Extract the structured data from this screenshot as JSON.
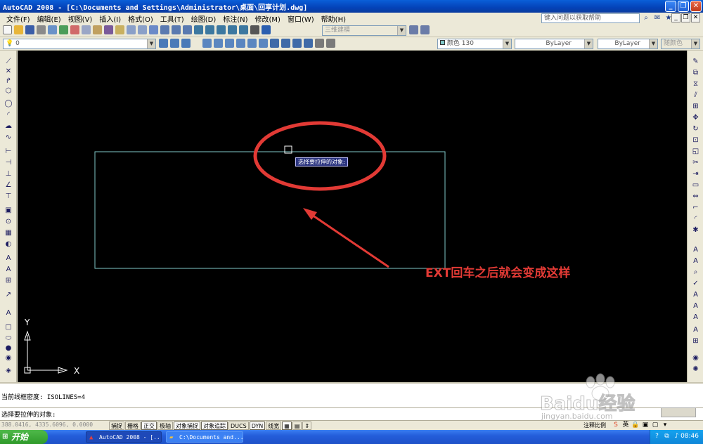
{
  "window": {
    "title": "AutoCAD 2008 - [C:\\Documents and Settings\\Administrator\\桌面\\回享计划.dwg]"
  },
  "menu": {
    "items": [
      "文件(F)",
      "编辑(E)",
      "视图(V)",
      "插入(I)",
      "格式(O)",
      "工具(T)",
      "绘图(D)",
      "标注(N)",
      "修改(M)",
      "窗口(W)",
      "帮助(H)"
    ],
    "help_placeholder": "键入问题以获取帮助"
  },
  "toolbar": {
    "workspace": "三维建模",
    "layer": "0",
    "color": "颜色 130",
    "linetype": "ByLayer",
    "lineweight": "ByLayer",
    "plotstyle": "随颜色"
  },
  "canvas": {
    "prompt_tooltip": "选择要拉伸的对象:",
    "annotation": "EXT回车之后就会变成这样",
    "ucs_x": "X",
    "ucs_y": "Y",
    "rect_color": "#7fc7c7",
    "annotation_color": "#e23a35"
  },
  "command": {
    "line1": "当前线框密度:  ISOLINES=4",
    "line2": "选择要拉伸的对象:"
  },
  "status": {
    "coords": "388.0416, 4335.6096, 0.0000",
    "modes": [
      "捕捉",
      "栅格",
      "正交",
      "极轴",
      "对象捕捉",
      "对象追踪",
      "DUCS",
      "DYN",
      "线宽"
    ],
    "annotation_scale": "注释比例"
  },
  "taskbar": {
    "start": "开始",
    "tasks": [
      "AutoCAD 2008 - [...",
      "C:\\Documents and..."
    ],
    "clock": "08:46"
  },
  "watermark": {
    "brand": "Baidu经验",
    "url": "jingyan.baidu.com"
  }
}
